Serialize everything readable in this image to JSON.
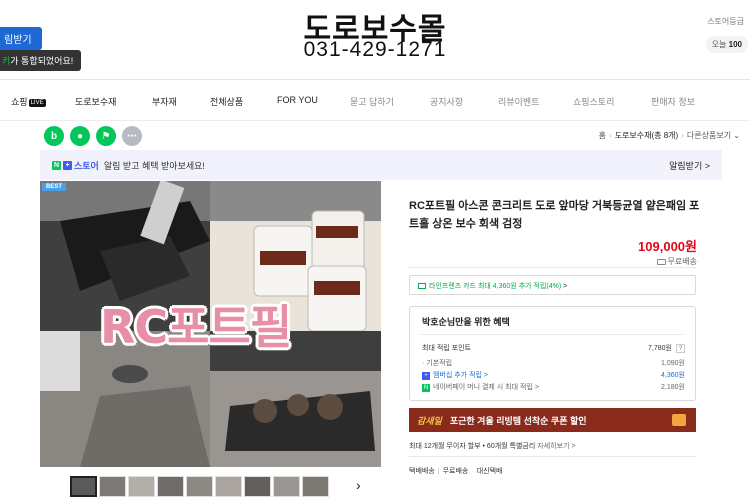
{
  "header": {
    "store_title": "도로보수몰",
    "phone": "031-429-1271",
    "notify_button": "림받기",
    "tooltip_prefix": "키",
    "tooltip_text": "가 통합되었어요!",
    "right_label": "스토어등급",
    "right_value_label": "오늘",
    "right_value": "100"
  },
  "nav": {
    "items": [
      {
        "label": "쇼핑",
        "badge": "LIVE"
      },
      {
        "label": "도로보수재"
      },
      {
        "label": "부자재"
      },
      {
        "label": "전체상품"
      },
      {
        "label": "FOR YOU"
      },
      {
        "label": "묻고 답하기"
      },
      {
        "label": "공지사항"
      },
      {
        "label": "리뷰이벤트"
      },
      {
        "label": "쇼핑스토리"
      },
      {
        "label": "판매자 정보"
      }
    ]
  },
  "share": {
    "icons": [
      "band-share-icon",
      "talk-share-icon",
      "naver-share-icon",
      "more-share-icon"
    ]
  },
  "breadcrumb": {
    "home": "홈",
    "category": "도로보수재(총 8개)",
    "sort": "다른상품보기"
  },
  "notice": {
    "brand": "스토어",
    "text": "알림 받고 혜택 받아보세요!",
    "button": "알림받기 >"
  },
  "product": {
    "badge": "BEST",
    "image_caption": "RC포트필",
    "title": "RC포트필 아스콘 콘크리트 도로 앞마당 거북등균열 얕은패임 포트홀 상온 보수 회색 검정",
    "price": "109,000원",
    "shipping": "무료배송",
    "card_offer_prefix": "라인프렌즈 카드 최대 ",
    "card_offer_highlight": "4,360원 추가 적립(4%)",
    "card_offer_suffix": " >"
  },
  "benefit": {
    "title": "박호순님만을 위한 혜택",
    "max_label": "최대 적립 포인트",
    "max_value": "7,780원",
    "help": "?",
    "rows": [
      {
        "label": "기본적립",
        "value": "1,090원"
      },
      {
        "label": "멤버십 추가 적립 >",
        "value": "4,360원"
      },
      {
        "label": "네이버페이 머니 결제 시 최대 적립 >",
        "value": "2,180원"
      }
    ]
  },
  "banner": {
    "tag": "감새일",
    "text": "포근한 겨울 리빙템 선착순 쿠폰 할인"
  },
  "installment": {
    "text": "최대 12개월 무이자 할부 • 60개월 특별금리",
    "link": "자세히보기 >"
  },
  "delivery": {
    "method": "택배배송",
    "fee": "무료배송",
    "note": "대신택배"
  },
  "colors": {
    "accent": "#1f69d6",
    "price": "#e0071b",
    "naver_green": "#03c75a",
    "banner_bg": "#8a2a1a"
  }
}
